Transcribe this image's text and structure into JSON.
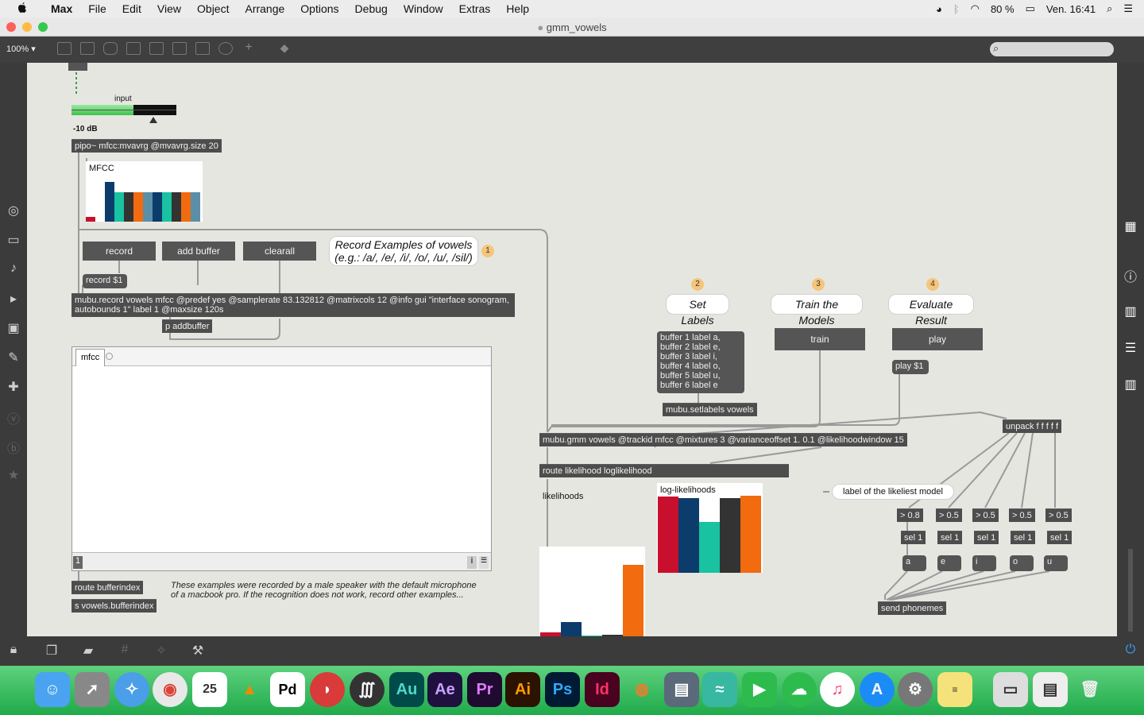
{
  "menubar": {
    "app": "Max",
    "items": [
      "File",
      "Edit",
      "View",
      "Object",
      "Arrange",
      "Options",
      "Debug",
      "Window",
      "Extras",
      "Help"
    ],
    "battery": "80 %",
    "clock": "Ven. 16:41"
  },
  "window": {
    "title": "gmm_vowels"
  },
  "toolbar": {
    "zoom": "100%"
  },
  "patch": {
    "meter_label": "input",
    "meter_db": "-10 dB",
    "pipo": "pipo~ mfcc:mvavrg @mvavrg.size 20",
    "mfcc_label": "MFCC",
    "btn_record": "record",
    "btn_add_buffer": "add buffer",
    "btn_clearall": "clearall",
    "bubble1": "Record Examples of vowels\n(e.g.: /a/, /e/, /i/, /o/, /u/, /sil/)",
    "badge1": "1",
    "record_msg": "record $1",
    "mubu_record": "mubu.record vowels mfcc @predef yes @samplerate 83.132812 @matrixcols 12 @info gui \"interface sonogram, autobounds 1\" label 1 @maxsize 120s",
    "p_addbuffer": "p addbuffer",
    "mfcc_tab": "mfcc",
    "buffer_field": "1",
    "route_bufferindex": "route bufferindex",
    "s_bufferindex": "s vowels.bufferindex",
    "note": "These examples were recorded by a male speaker with the default microphone of a macbook pro. If the recognition does not work, record other examples...",
    "badge2": "2",
    "bubble2": "Set Labels",
    "badge3": "3",
    "bubble3": "Train the Models",
    "badge4": "4",
    "bubble4": "Evaluate Result",
    "labels_msg": "buffer 1 label a,\nbuffer 2 label e,\nbuffer 3 label i,\nbuffer 4 label o,\nbuffer 5 label u,\nbuffer 6 label e",
    "setlabels": "mubu.setlabels vowels",
    "btn_train": "train",
    "btn_play": "play",
    "play_msg": "play $1",
    "gmm": "mubu.gmm vowels @trackid mfcc @mixtures 3 @varianceoffset 1. 0.1 @likelihoodwindow 15",
    "unpack": "unpack f f f f f",
    "route_likelihood": "route likelihood loglikelihood",
    "likelihoods_label": "likelihoods",
    "loglik_label": "log-likelihoods",
    "likeliest_label": "label of the likeliest model",
    "thresholds": [
      "> 0.8",
      "> 0.5",
      "> 0.5",
      "> 0.5",
      "> 0.5"
    ],
    "sels": [
      "sel 1",
      "sel 1",
      "sel 1",
      "sel 1",
      "sel 1"
    ],
    "vowels": [
      "a",
      "e",
      "i",
      "o",
      "u"
    ],
    "send_phonemes": "send phonemes",
    "mfcc_values": [
      0.1,
      0.6,
      0.8,
      0.6,
      0.6,
      0.6,
      0.6,
      0.6,
      0.6,
      0.6,
      0.6,
      0.6
    ],
    "loglik_values": [
      0.85,
      0.83,
      0.57,
      0.83,
      0.86
    ],
    "lik_values": [
      0.04,
      0.16,
      0.01,
      0.02,
      0.8
    ]
  },
  "colors": {
    "bar_colors": [
      "#c8102e",
      "#0b3c6b",
      "#19c2a0",
      "#333333",
      "#f26b0f"
    ]
  }
}
